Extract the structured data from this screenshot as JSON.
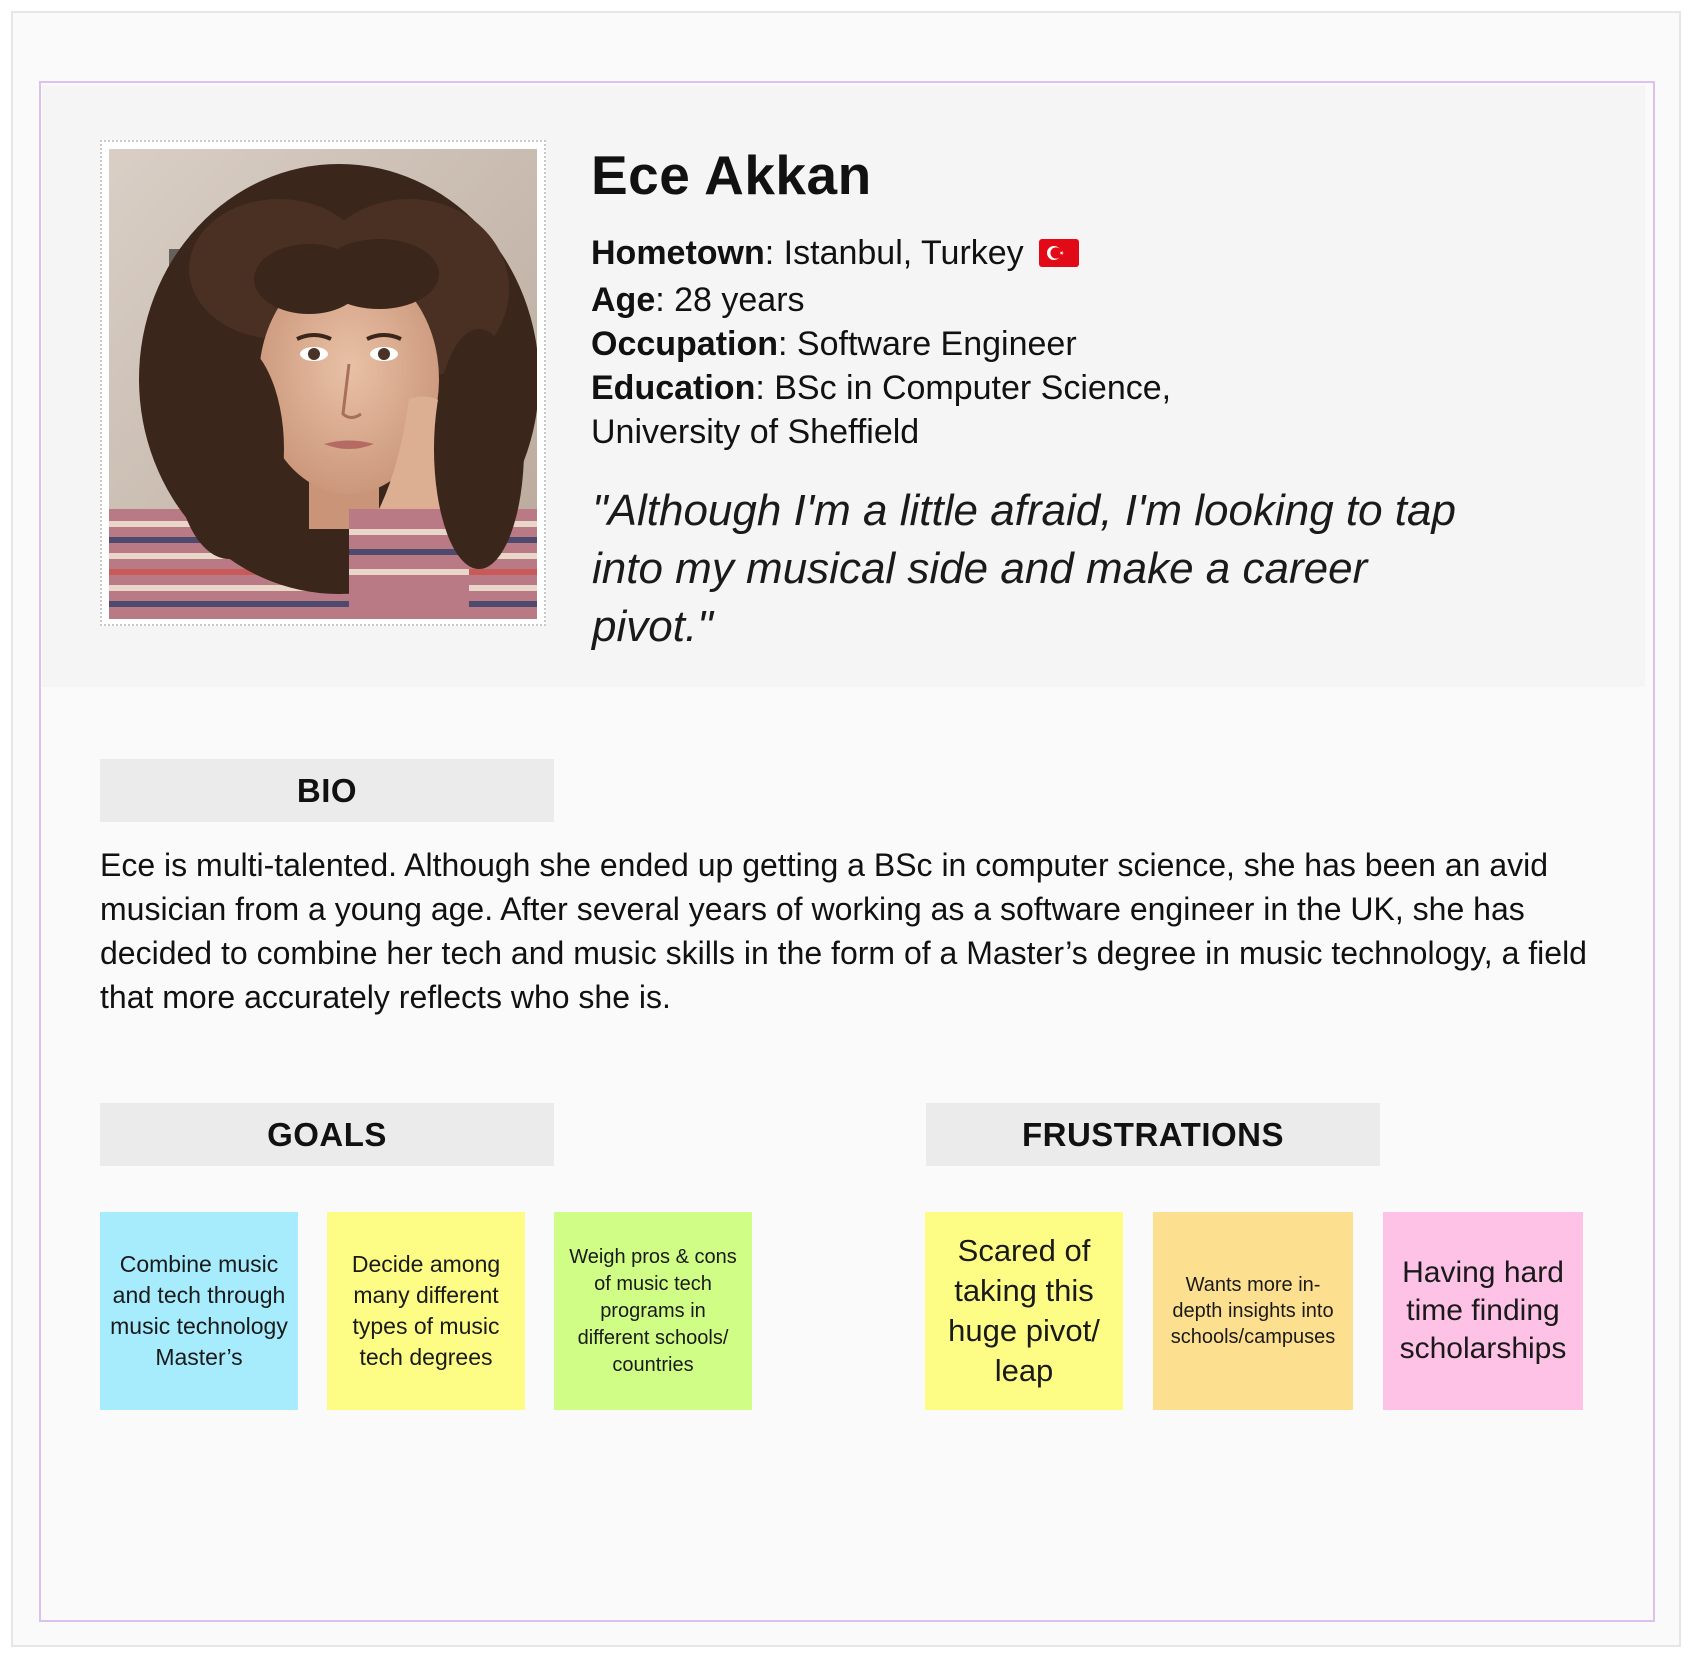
{
  "persona": {
    "name": "Ece Akkan",
    "hometown_label": "Hometown",
    "hometown_value": ": Istanbul, Turkey",
    "age_label": "Age",
    "age_value": ": 28 years",
    "occupation_label": "Occupation",
    "occupation_value": ": Software Engineer",
    "education_label": "Education",
    "education_value": ": BSc in Computer Science,",
    "education_value_line2": "University of Sheffield",
    "quote": "\"Although I'm a little afraid, I'm looking to tap into my musical side and make a career pivot.\""
  },
  "bio": {
    "heading": "BIO",
    "text": "Ece is multi-talented. Although she ended up getting a BSc in computer science, she has been an avid musician from a young age. After several years of working as a software engineer in the UK, she has decided to combine her tech and music skills in the form of a Master’s degree in music technology, a field that more accurately reflects who she is."
  },
  "goals": {
    "heading": "GOALS",
    "notes": [
      {
        "text": "Combine music and tech through music technology Master’s",
        "color": "#a6ecfd"
      },
      {
        "text": "Decide among many different types of music tech degrees",
        "color": "#fdfd86"
      },
      {
        "text": "Weigh pros & cons of music tech programs in different schools/ countries",
        "color": "#cffd86"
      }
    ]
  },
  "frustrations": {
    "heading": "FRUSTRATIONS",
    "notes": [
      {
        "text": "Scared of taking this huge pivot/ leap",
        "color": "#fdfd86"
      },
      {
        "text": "Wants more in-depth insights into schools/campuses",
        "color": "#fde08f"
      },
      {
        "text": "Having hard time finding scholarships",
        "color": "#fdc2e6"
      }
    ]
  },
  "colors": {
    "frame_border": "#dcc0f0",
    "header_bg": "#f5f5f5",
    "section_head_bg": "#ebebeb"
  },
  "icons": {
    "flag": "turkey-flag-icon"
  }
}
